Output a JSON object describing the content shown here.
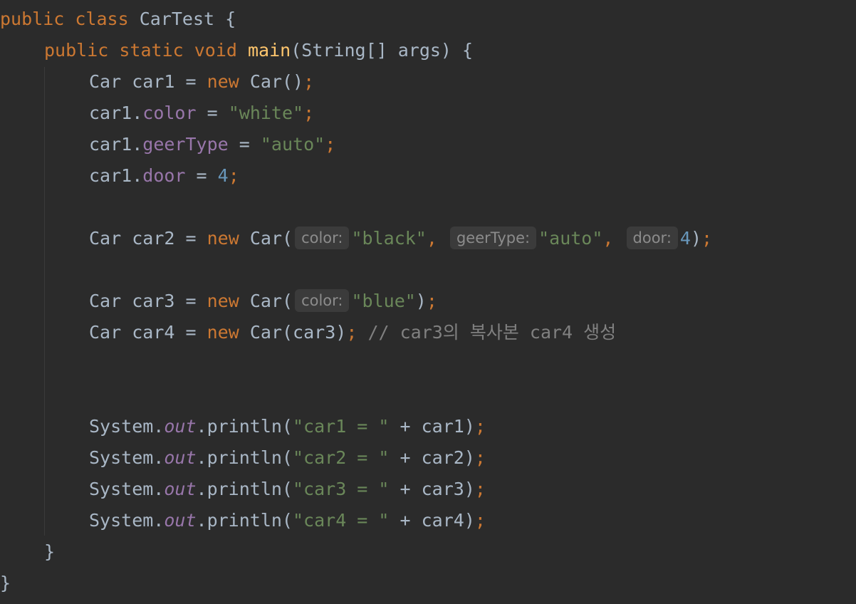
{
  "code": {
    "class_kw": "public class",
    "class_name": "CarTest",
    "open_brace": "{",
    "close_brace": "}",
    "main_kw": "public static void",
    "main_name": "main",
    "main_params": "(String[] args) {",
    "car_type": "Car",
    "eq": "=",
    "new_kw": "new",
    "semi": ";",
    "car1_decl": "car1",
    "car1_ctor": "Car()",
    "car1_prefix": "car1.",
    "color_field": "color",
    "color_value": "\"white\"",
    "geer_field": "geerType",
    "geer_value": "\"auto\"",
    "door_field": "door",
    "door_value": "4",
    "car2_decl": "car2",
    "ctor_open": "Car(",
    "hint_color": "color:",
    "hint_geer": "geerType:",
    "hint_door": "door:",
    "car2_color_arg": "\"black\"",
    "car2_geer_arg": "\"auto\"",
    "car2_door_arg": "4",
    "comma": ",",
    "close_paren": ")",
    "car3_decl": "car3",
    "car3_color_arg": "\"blue\"",
    "car4_decl": "car4",
    "car4_ctor": "Car(car3)",
    "car4_comment": "// car3의 복사본 car4 생성",
    "system": "System.",
    "out_field": "out",
    "println": ".println(",
    "print1_str": "\"car1 = \"",
    "print1_rest": "+ car1)",
    "print2_str": "\"car2 = \"",
    "print2_rest": "+ car2)",
    "print3_str": "\"car3 = \"",
    "print3_rest": "+ car3)",
    "print4_str": "\"car4 = \"",
    "print4_rest": "+ car4)"
  },
  "colors": {
    "background": "#2b2b2b",
    "keyword": "#cc7832",
    "method": "#ffc66d",
    "string": "#6a8759",
    "number": "#6897bb",
    "field": "#9876aa",
    "comment": "#808080",
    "text": "#a9b7c6"
  }
}
